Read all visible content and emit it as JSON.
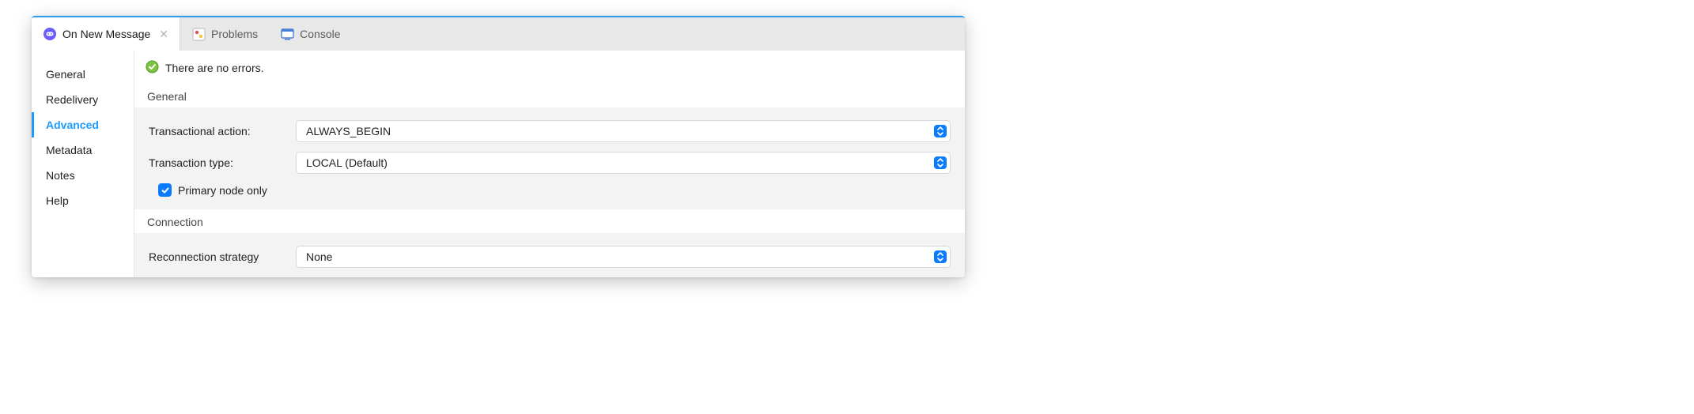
{
  "tabs": {
    "active": {
      "label": "On New Message"
    },
    "problems": {
      "label": "Problems"
    },
    "console": {
      "label": "Console"
    }
  },
  "sidebar": {
    "items": [
      {
        "label": "General"
      },
      {
        "label": "Redelivery"
      },
      {
        "label": "Advanced"
      },
      {
        "label": "Metadata"
      },
      {
        "label": "Notes"
      },
      {
        "label": "Help"
      }
    ]
  },
  "status": {
    "message": "There are no errors."
  },
  "sections": {
    "general": {
      "title": "General",
      "transactional_action": {
        "label": "Transactional action:",
        "value": "ALWAYS_BEGIN"
      },
      "transaction_type": {
        "label": "Transaction type:",
        "value": "LOCAL (Default)"
      },
      "primary_node": {
        "label": "Primary node only",
        "checked": true
      }
    },
    "connection": {
      "title": "Connection",
      "reconnection_strategy": {
        "label": "Reconnection strategy",
        "value": "None"
      }
    }
  }
}
